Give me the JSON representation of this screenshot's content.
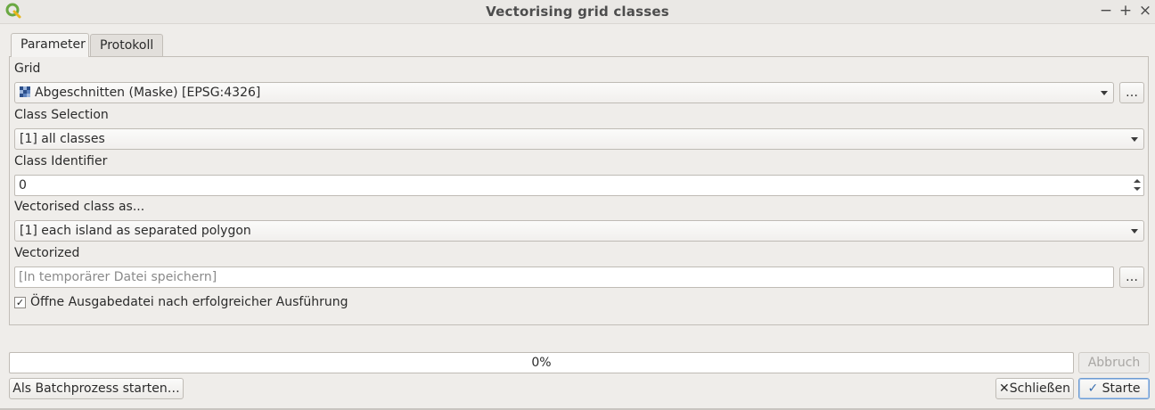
{
  "window": {
    "title": "Vectorising grid classes",
    "controls": {
      "minimize": "−",
      "maximize": "+",
      "close": "×"
    }
  },
  "tabs": [
    {
      "label": "Parameter",
      "active": true
    },
    {
      "label": "Protokoll",
      "active": false
    }
  ],
  "params": {
    "grid": {
      "label": "Grid",
      "value": "Abgeschnitten (Maske) [EPSG:4326]",
      "icon": "raster-layer-icon",
      "browse": "…"
    },
    "class_selection": {
      "label": "Class Selection",
      "value": "[1] all classes"
    },
    "class_identifier": {
      "label": "Class Identifier",
      "value": "0"
    },
    "vectorised_as": {
      "label": "Vectorised class as...",
      "value": "[1] each island as separated polygon"
    },
    "vectorized": {
      "label": "Vectorized",
      "placeholder": "[In temporärer Datei speichern]",
      "browse": "…"
    },
    "open_output": {
      "label": "Öffne Ausgabedatei nach erfolgreicher Ausführung",
      "checked": true
    }
  },
  "progress": {
    "value": 0,
    "text": "0%",
    "cancel_label": "Abbruch"
  },
  "footer": {
    "batch_label": "Als Batchprozess starten…",
    "close_label": "Schließen",
    "run_label": "Starte"
  },
  "colors": {
    "accent": "#5a93d6",
    "default_button_border": "#6d9bd1",
    "qgis_green": "#6aa842"
  }
}
